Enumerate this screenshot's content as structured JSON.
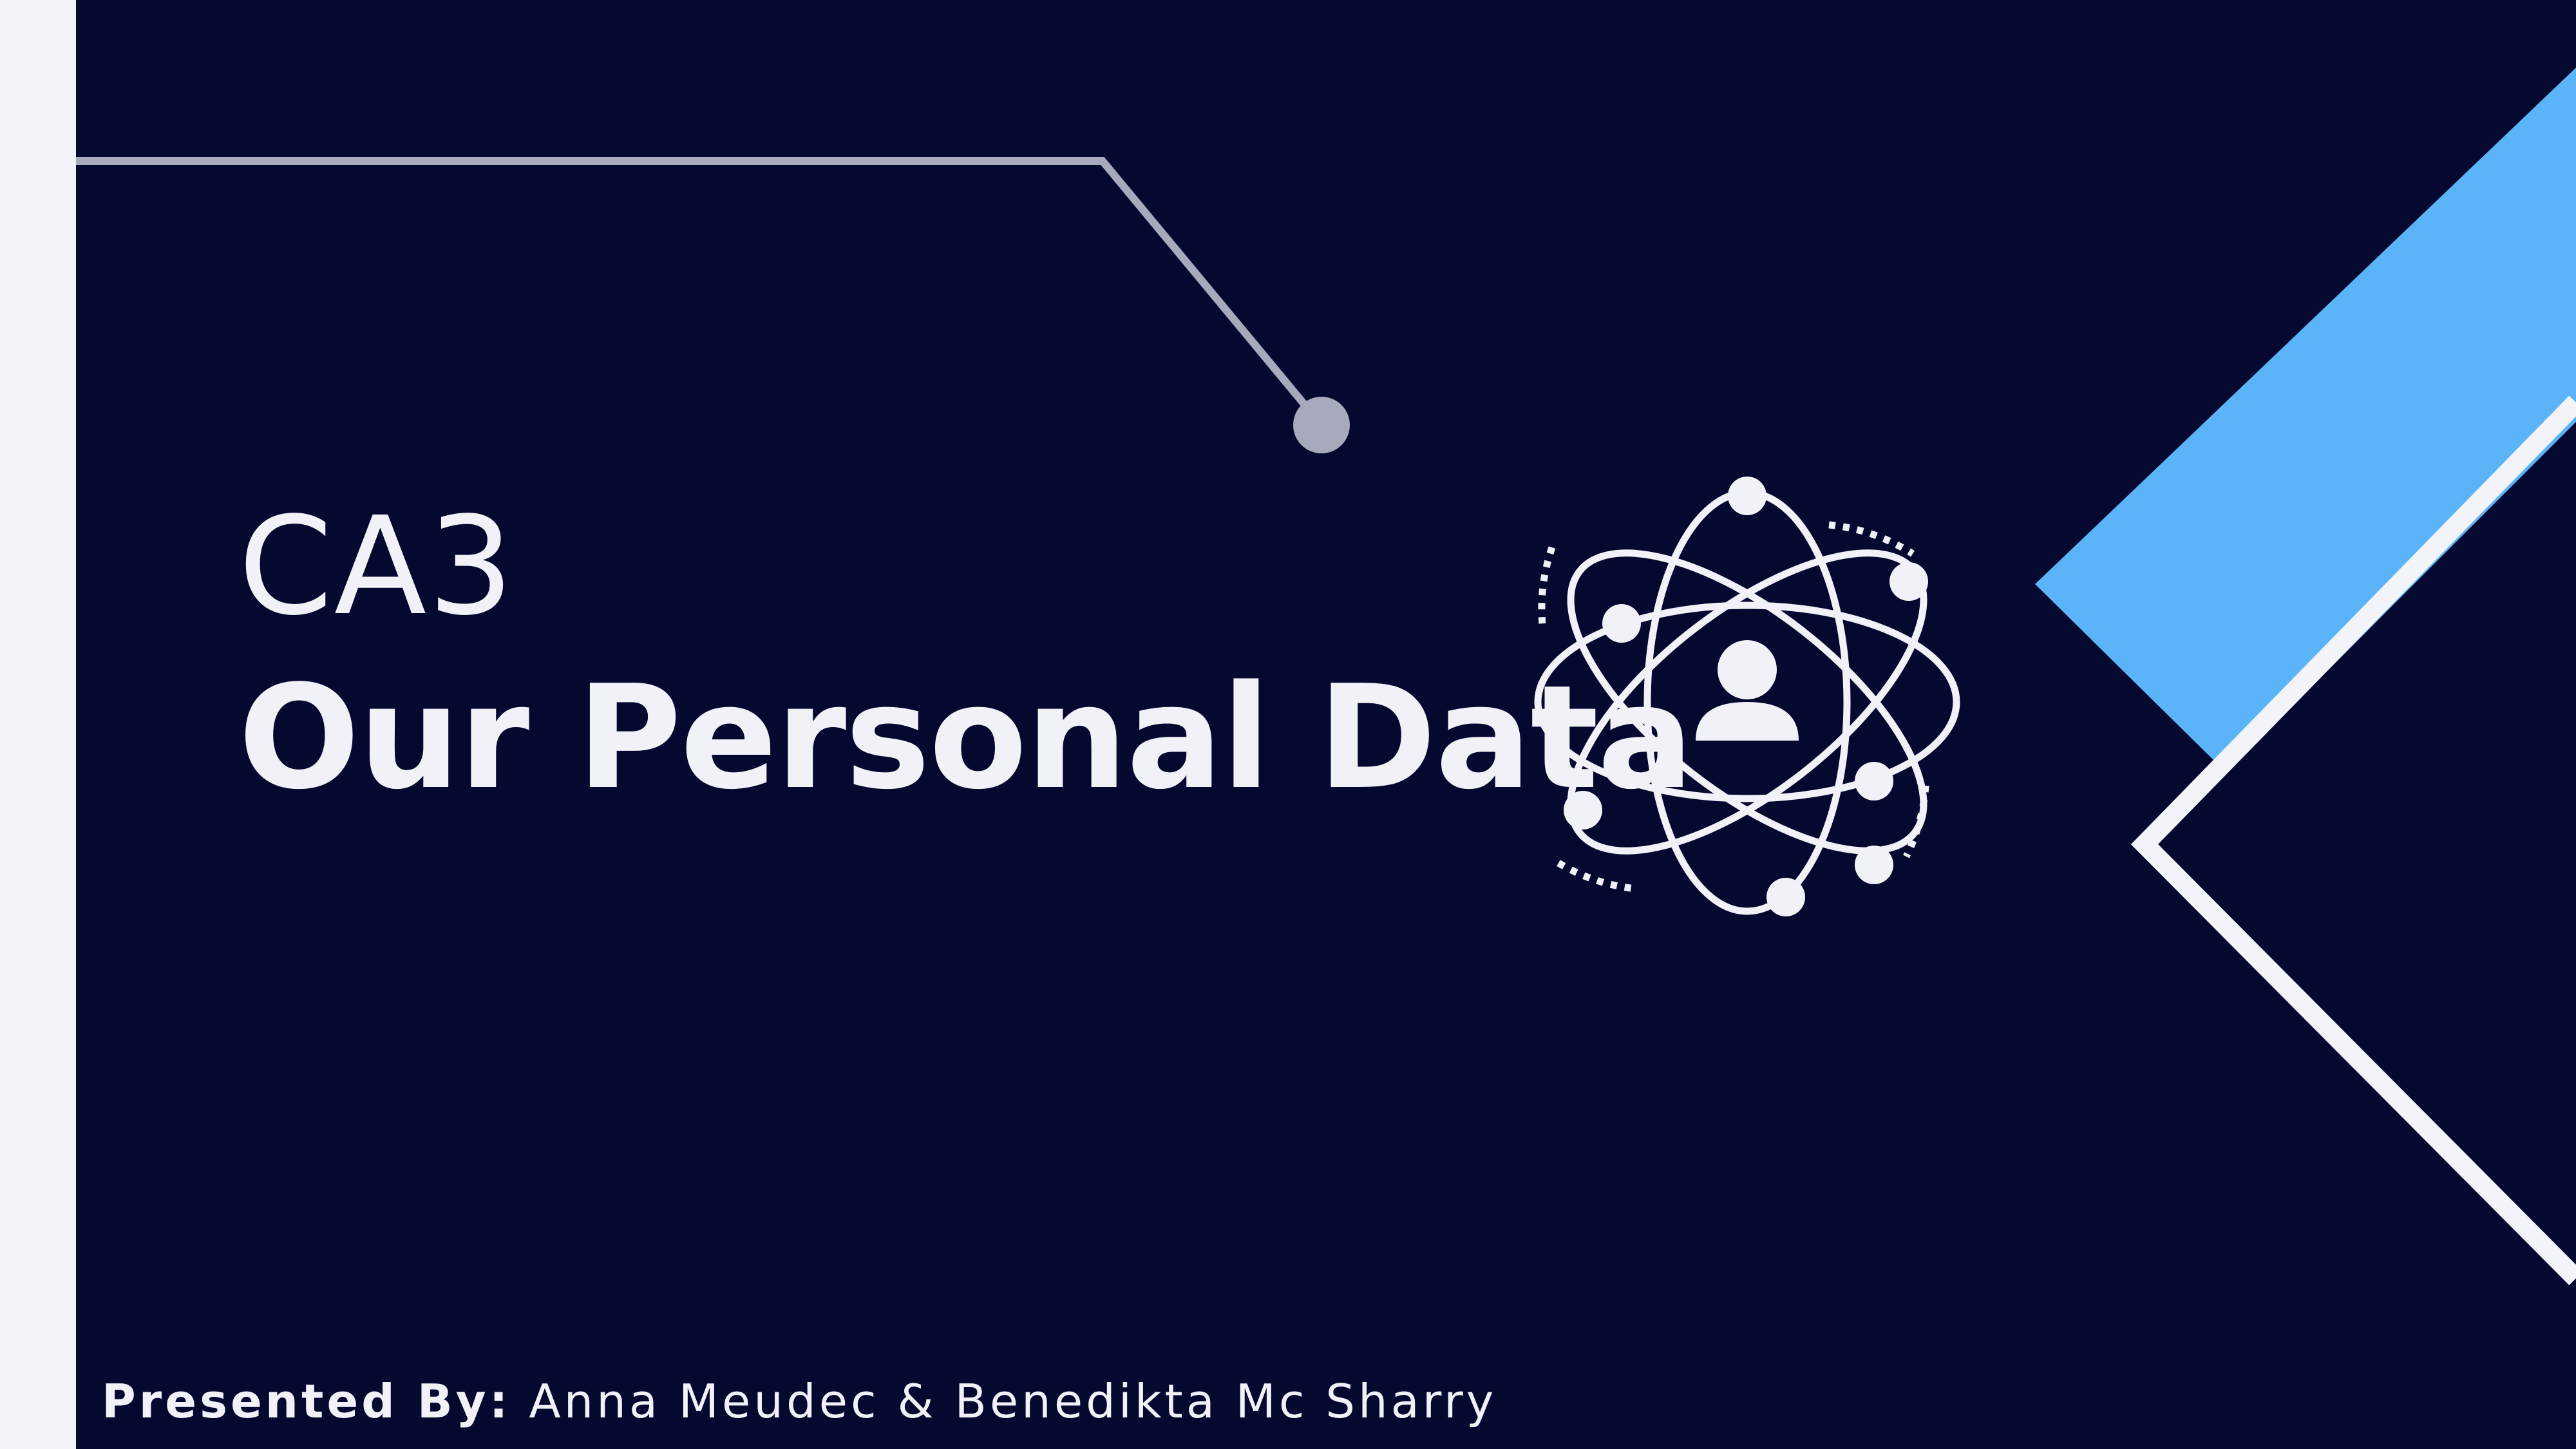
{
  "slide": {
    "subtitle": "CA3",
    "title": "Our Personal Data",
    "presented_by_label": "Presented By:",
    "presenters": "Anna Meudec & Benedikta Mc Sharry"
  },
  "colors": {
    "background": "#050930",
    "text": "#f1f1f8",
    "accent_blue": "#5bb4f7",
    "line_gray": "#a7aabd",
    "left_strip": "#f3f3fa"
  },
  "icons": {
    "center": "atom-person-icon"
  }
}
